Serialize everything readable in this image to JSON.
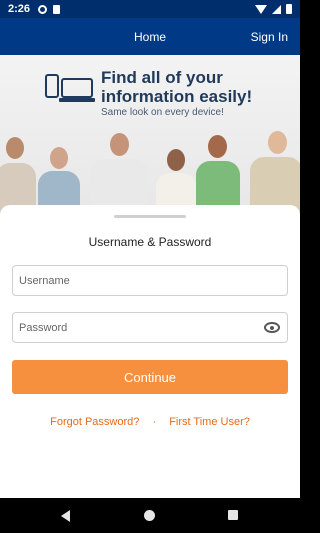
{
  "status_bar": {
    "time": "2:26",
    "icons": [
      "gear-icon",
      "sim-card-icon",
      "wifi-icon",
      "signal-icon",
      "battery-icon"
    ]
  },
  "nav": {
    "home_label": "Home",
    "signin_label": "Sign In"
  },
  "hero": {
    "title": "Find all of your information easily!",
    "subtitle": "Same look on every device!"
  },
  "login": {
    "heading": "Username & Password",
    "username_placeholder": "Username",
    "password_placeholder": "Password",
    "continue_label": "Continue",
    "forgot_password_label": "Forgot Password?",
    "separator": "·",
    "first_time_user_label": "First Time User?"
  },
  "colors": {
    "nav_background": "#003a87",
    "accent_orange": "#f7903e",
    "link_orange": "#e86a19"
  }
}
